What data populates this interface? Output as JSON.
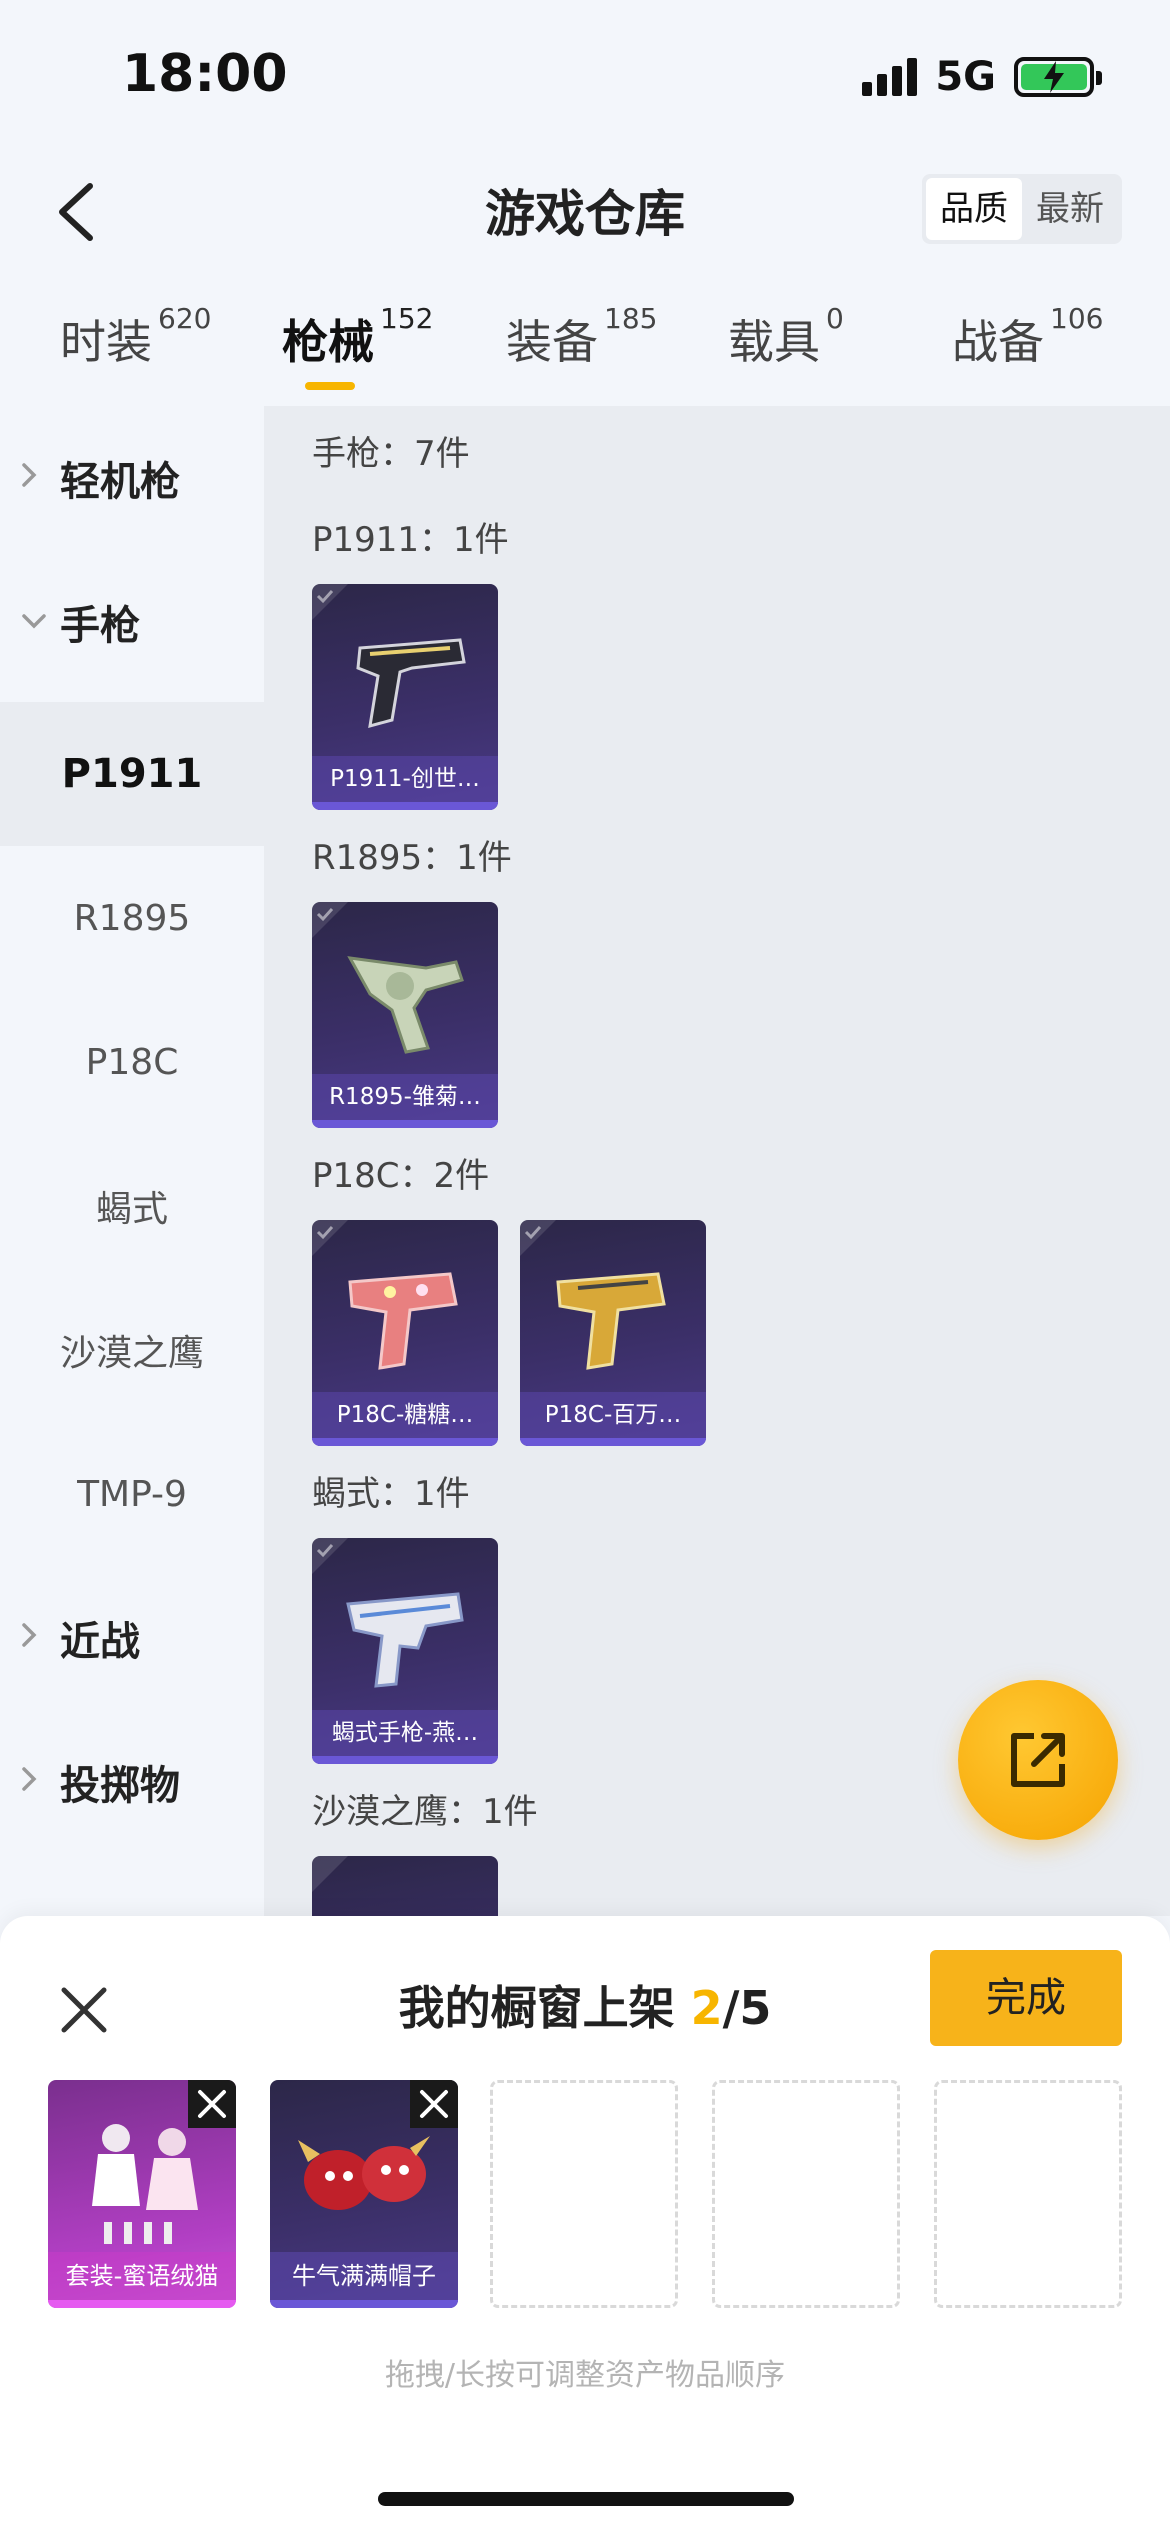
{
  "status_bar": {
    "time": "18:00",
    "network": "5G"
  },
  "header": {
    "title": "游戏仓库",
    "sort_options": [
      "品质",
      "最新"
    ]
  },
  "tabs": [
    {
      "label": "时装",
      "count": "620"
    },
    {
      "label": "枪械",
      "count": "152"
    },
    {
      "label": "装备",
      "count": "185"
    },
    {
      "label": "载具",
      "count": "0"
    },
    {
      "label": "战备",
      "count": "106"
    }
  ],
  "sidebar": {
    "items": [
      {
        "label": "轻机枪",
        "type": "group",
        "expanded": false
      },
      {
        "label": "手枪",
        "type": "group",
        "expanded": true
      },
      {
        "label": "P1911",
        "type": "sub",
        "active": true
      },
      {
        "label": "R1895",
        "type": "sub"
      },
      {
        "label": "P18C",
        "type": "sub"
      },
      {
        "label": "蝎式",
        "type": "sub"
      },
      {
        "label": "沙漠之鹰",
        "type": "sub"
      },
      {
        "label": "TMP-9",
        "type": "sub"
      },
      {
        "label": "近战",
        "type": "group",
        "expanded": false
      },
      {
        "label": "投掷物",
        "type": "group",
        "expanded": false
      }
    ]
  },
  "main": {
    "category_header": "手枪：7件",
    "sections": [
      {
        "title": "P1911：1件",
        "items": [
          {
            "label": "P1911-创世…"
          }
        ]
      },
      {
        "title": "R1895：1件",
        "items": [
          {
            "label": "R1895-雏菊…"
          }
        ]
      },
      {
        "title": "P18C：2件",
        "items": [
          {
            "label": "P18C-糖糖…"
          },
          {
            "label": "P18C-百万…"
          }
        ]
      },
      {
        "title": "蝎式：1件",
        "items": [
          {
            "label": "蝎式手枪-燕…"
          }
        ]
      },
      {
        "title": "沙漠之鹰：1件",
        "items": []
      }
    ]
  },
  "sheet": {
    "title_prefix": "我的橱窗上架 ",
    "current": "2",
    "total": "/5",
    "done_label": "完成",
    "slots": [
      {
        "label": "套装-蜜语绒猫",
        "rarity": "pink"
      },
      {
        "label": "牛气满满帽子",
        "rarity": "purple"
      },
      null,
      null,
      null
    ],
    "hint": "拖拽/长按可调整资产物品顺序"
  },
  "colors": {
    "accent": "#f7b500",
    "card_purple": "#4a3a86",
    "card_pink": "#b23fc4"
  }
}
